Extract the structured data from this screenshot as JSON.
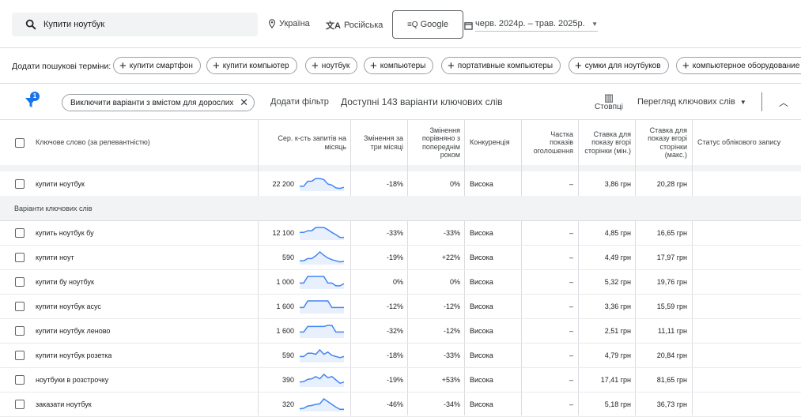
{
  "search": {
    "query": "Купити ноутбук"
  },
  "location": "Україна",
  "language": "Російська",
  "network": "Google",
  "date_range": "черв. 2024р. – трав. 2025р.",
  "terms_bar": {
    "label": "Додати пошукові терміни:",
    "chips": [
      "купити смартфон",
      "купити компьютер",
      "ноутбук",
      "компьютеры",
      "портативные компьютеры",
      "сумки для ноутбуков",
      "компьютерное оборудование"
    ]
  },
  "filter_bar": {
    "badge": "1",
    "filter_chip": "Виключити варіанти з вмістом для дорослих",
    "add_filter": "Додати фільтр",
    "available": "Доступні 143 варіанти ключових слів",
    "columns": "Стовпці",
    "view": "Перегляд ключових слів"
  },
  "table": {
    "headers": {
      "keyword": "Ключове слово (за релевантністю)",
      "volume": "Сер. к-сть запитів на місяць",
      "change_3m": "Змінення за три місяці",
      "change_yoy": "Змінення порівняно з попереднім роком",
      "competition": "Конкуренція",
      "share": "Частка показів оголошення",
      "bid_min": "Ставка для показу вгорі сторінки (мін.)",
      "bid_max": "Ставка для показу вгорі сторінки (макс.)",
      "status": "Статус облікового запису"
    },
    "group_label": "Варіанти ключових слів",
    "main_row": {
      "keyword": "купити ноутбук",
      "volume": "22 200",
      "change_3m": "-18%",
      "change_yoy": "0%",
      "competition": "Висока",
      "share": "–",
      "bid_min": "3,86 грн",
      "bid_max": "20,28 грн",
      "trend": [
        0.3,
        0.3,
        0.75,
        0.75,
        1,
        1,
        0.9,
        0.5,
        0.4,
        0.15,
        0.1,
        0.2
      ]
    },
    "rows": [
      {
        "keyword": "купить ноутбук бу",
        "volume": "12 100",
        "change_3m": "-33%",
        "change_yoy": "-33%",
        "competition": "Висока",
        "share": "–",
        "bid_min": "4,85 грн",
        "bid_max": "16,65 грн",
        "trend": [
          0.55,
          0.55,
          0.7,
          0.7,
          1,
          1,
          1,
          0.8,
          0.55,
          0.35,
          0.1,
          0.1
        ]
      },
      {
        "keyword": "купити ноут",
        "volume": "590",
        "change_3m": "-19%",
        "change_yoy": "+22%",
        "competition": "Висока",
        "share": "–",
        "bid_min": "4,49 грн",
        "bid_max": "17,97 грн",
        "trend": [
          0.2,
          0.2,
          0.4,
          0.4,
          0.65,
          1,
          0.7,
          0.45,
          0.3,
          0.2,
          0.1,
          0.15
        ]
      },
      {
        "keyword": "купити бу ноутбук",
        "volume": "1 000",
        "change_3m": "0%",
        "change_yoy": "0%",
        "competition": "Висока",
        "share": "–",
        "bid_min": "5,32 грн",
        "bid_max": "19,76 грн",
        "trend": [
          0.4,
          0.4,
          1,
          1,
          1,
          1,
          1,
          0.4,
          0.4,
          0.15,
          0.15,
          0.35
        ]
      },
      {
        "keyword": "купити ноутбук асус",
        "volume": "1 600",
        "change_3m": "-12%",
        "change_yoy": "-12%",
        "competition": "Висока",
        "share": "–",
        "bid_min": "3,36 грн",
        "bid_max": "15,59 грн",
        "trend": [
          0.4,
          0.4,
          1,
          1,
          1,
          1,
          1,
          1,
          0.4,
          0.4,
          0.4,
          0.4
        ]
      },
      {
        "keyword": "купити ноутбук леново",
        "volume": "1 600",
        "change_3m": "-32%",
        "change_yoy": "-12%",
        "competition": "Висока",
        "share": "–",
        "bid_min": "2,51 грн",
        "bid_max": "11,11 грн",
        "trend": [
          0.4,
          0.4,
          0.9,
          0.9,
          0.9,
          0.9,
          0.9,
          1,
          1,
          0.4,
          0.4,
          0.4
        ]
      },
      {
        "keyword": "купити ноутбук розетка",
        "volume": "590",
        "change_3m": "-18%",
        "change_yoy": "-33%",
        "competition": "Висока",
        "share": "–",
        "bid_min": "4,79 грн",
        "bid_max": "20,84 грн",
        "trend": [
          0.4,
          0.4,
          0.7,
          0.7,
          0.6,
          1,
          0.6,
          0.8,
          0.5,
          0.4,
          0.3,
          0.4
        ]
      },
      {
        "keyword": "ноутбуки в розстрочку",
        "volume": "390",
        "change_3m": "-19%",
        "change_yoy": "+53%",
        "competition": "Висока",
        "share": "–",
        "bid_min": "17,41 грн",
        "bid_max": "81,65 грн",
        "trend": [
          0.3,
          0.35,
          0.55,
          0.6,
          0.8,
          0.6,
          1,
          0.7,
          0.8,
          0.5,
          0.2,
          0.3
        ]
      },
      {
        "keyword": "заказати ноутбук",
        "volume": "320",
        "change_3m": "-46%",
        "change_yoy": "-34%",
        "competition": "Висока",
        "share": "–",
        "bid_min": "5,18 грн",
        "bid_max": "36,73 грн",
        "trend": [
          0.1,
          0.15,
          0.35,
          0.4,
          0.5,
          0.55,
          1,
          0.75,
          0.5,
          0.25,
          0.05,
          0.05
        ]
      }
    ]
  }
}
